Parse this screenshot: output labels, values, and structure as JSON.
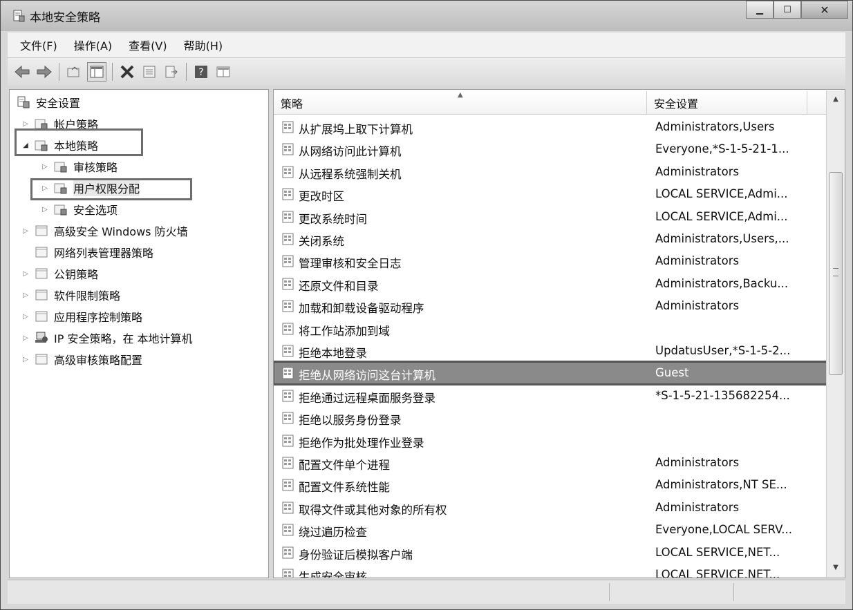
{
  "window": {
    "title": "本地安全策略"
  },
  "menu": [
    "文件(F)",
    "操作(A)",
    "查看(V)",
    "帮助(H)"
  ],
  "toolbar": [
    "back-icon",
    "forward-icon",
    "up-folder-icon",
    "show-hide-tree-icon",
    "delete-icon",
    "properties-icon",
    "export-list-icon",
    "help-icon",
    "view-icon"
  ],
  "tree": [
    {
      "label": "安全设置",
      "icon": "security-settings-icon",
      "level": 0,
      "expander": ""
    },
    {
      "label": "帐户策略",
      "icon": "folder-lock-icon",
      "level": 1,
      "expander": "▷"
    },
    {
      "label": "本地策略",
      "icon": "folder-lock-icon",
      "level": 1,
      "expander": "◢"
    },
    {
      "label": "审核策略",
      "icon": "folder-lock-icon",
      "level": 2,
      "expander": "▷"
    },
    {
      "label": "用户权限分配",
      "icon": "folder-lock-icon",
      "level": 2,
      "expander": "▷"
    },
    {
      "label": "安全选项",
      "icon": "folder-lock-icon",
      "level": 2,
      "expander": "▷"
    },
    {
      "label": "高级安全 Windows 防火墙",
      "icon": "folder-icon",
      "level": 1,
      "expander": "▷"
    },
    {
      "label": "网络列表管理器策略",
      "icon": "folder-icon",
      "level": 1,
      "expander": ""
    },
    {
      "label": "公钥策略",
      "icon": "folder-icon",
      "level": 1,
      "expander": "▷"
    },
    {
      "label": "软件限制策略",
      "icon": "folder-icon",
      "level": 1,
      "expander": "▷"
    },
    {
      "label": "应用程序控制策略",
      "icon": "folder-icon",
      "level": 1,
      "expander": "▷"
    },
    {
      "label": "IP 安全策略，在 本地计算机",
      "icon": "ip-security-icon",
      "level": 1,
      "expander": "▷"
    },
    {
      "label": "高级审核策略配置",
      "icon": "folder-icon",
      "level": 1,
      "expander": "▷"
    }
  ],
  "columns": {
    "policy": "策略",
    "setting": "安全设置"
  },
  "policies": [
    {
      "name": "从扩展坞上取下计算机",
      "setting": "Administrators,Users"
    },
    {
      "name": "从网络访问此计算机",
      "setting": "Everyone,*S-1-5-21-1..."
    },
    {
      "name": "从远程系统强制关机",
      "setting": "Administrators"
    },
    {
      "name": "更改时区",
      "setting": "LOCAL SERVICE,Admi..."
    },
    {
      "name": "更改系统时间",
      "setting": "LOCAL SERVICE,Admi..."
    },
    {
      "name": "关闭系统",
      "setting": "Administrators,Users,..."
    },
    {
      "name": "管理审核和安全日志",
      "setting": "Administrators"
    },
    {
      "name": "还原文件和目录",
      "setting": "Administrators,Backu..."
    },
    {
      "name": "加载和卸载设备驱动程序",
      "setting": "Administrators"
    },
    {
      "name": "将工作站添加到域",
      "setting": ""
    },
    {
      "name": "拒绝本地登录",
      "setting": "UpdatusUser,*S-1-5-2..."
    },
    {
      "name": "拒绝从网络访问这台计算机",
      "setting": "Guest"
    },
    {
      "name": "拒绝通过远程桌面服务登录",
      "setting": "*S-1-5-21-135682254..."
    },
    {
      "name": "拒绝以服务身份登录",
      "setting": ""
    },
    {
      "name": "拒绝作为批处理作业登录",
      "setting": ""
    },
    {
      "name": "配置文件单个进程",
      "setting": "Administrators"
    },
    {
      "name": "配置文件系统性能",
      "setting": "Administrators,NT SE..."
    },
    {
      "name": "取得文件或其他对象的所有权",
      "setting": "Administrators"
    },
    {
      "name": "绕过遍历检查",
      "setting": "Everyone,LOCAL SERV..."
    },
    {
      "name": "身份验证后模拟客户端",
      "setting": "LOCAL SERVICE,NET..."
    },
    {
      "name": "生成安全审核",
      "setting": "LOCAL SERVICE,NET..."
    }
  ],
  "selected_policy": "拒绝从网络访问这台计算机",
  "colors": {
    "selection": "#8a8a8a",
    "highlight_box": "#6d6d6d"
  }
}
